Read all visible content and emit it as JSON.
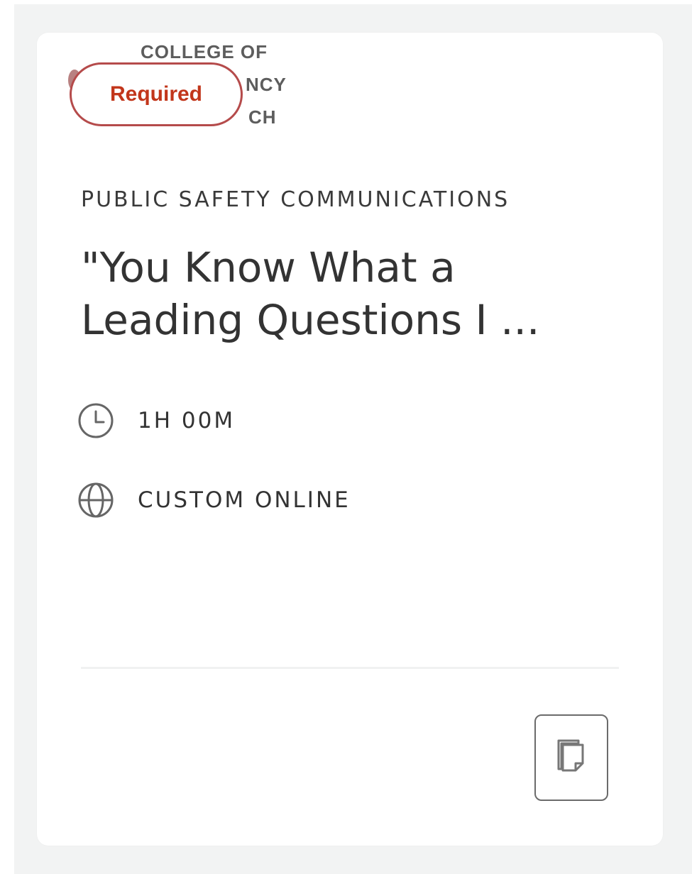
{
  "logo": {
    "lines": [
      "COLLEGE OF",
      "EMERGENCY",
      "DISPATCH"
    ],
    "visible_lines": [
      "COLLEGE OF",
      "NCY",
      "CH"
    ]
  },
  "card": {
    "badge": "Required",
    "category": "PUBLIC SAFETY COMMUNICATIONS",
    "title": "\"You Know What a Leading Questions I ...",
    "duration": {
      "icon": "clock-icon",
      "text": "1H 00M"
    },
    "format": {
      "icon": "globe-icon",
      "text": "CUSTOM ONLINE"
    },
    "action_icon": "copy-icon"
  },
  "colors": {
    "badge_border": "#b54b4b",
    "badge_text": "#c2361b",
    "text_primary": "#333333",
    "page_background": "#f2f3f3"
  }
}
